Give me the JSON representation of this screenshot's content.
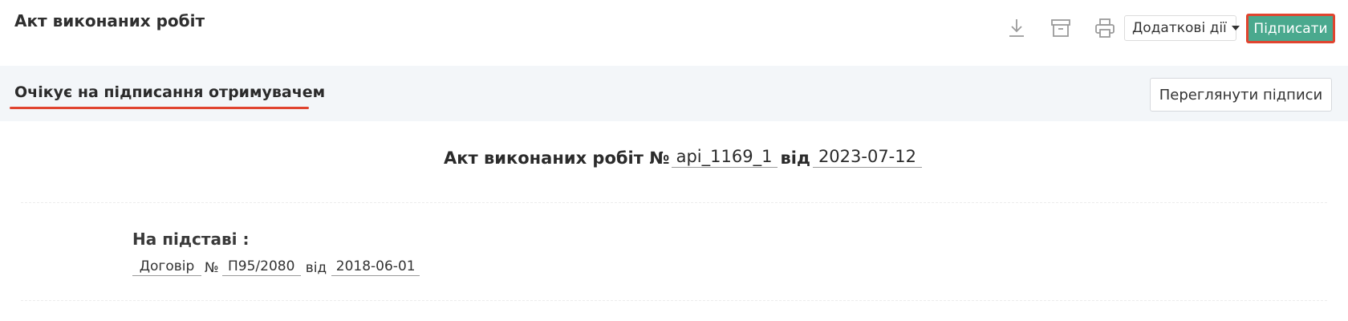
{
  "header": {
    "title": "Акт виконаних робіт",
    "icons": [
      "download-icon",
      "archive-icon",
      "print-icon"
    ],
    "more_actions_label": "Додаткові дії",
    "sign_label": "Підписати"
  },
  "status": {
    "text": "Очікує на підписання отримувачем",
    "view_signatures_label": "Переглянути підписи"
  },
  "document": {
    "title_label": "Акт виконаних робіт №",
    "number": "api_1169_1",
    "from_label": "від",
    "date": "2023-07-12"
  },
  "basis": {
    "label": "На підставі :",
    "doc_type": "Договір",
    "number_sign": "№",
    "number": "П95/2080",
    "from_label": "від",
    "date": "2018-06-01"
  },
  "colors": {
    "accent_green": "#4aa98e",
    "highlight_red": "#e0442f",
    "band_background": "#f3f6f9"
  }
}
